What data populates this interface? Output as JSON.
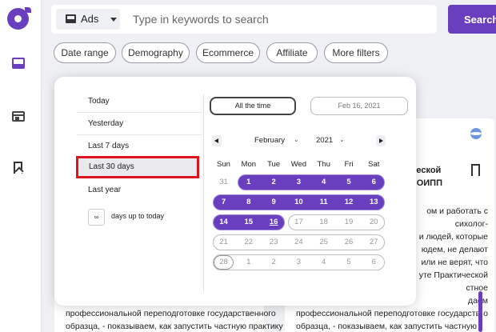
{
  "search": {
    "type_label": "Ads",
    "placeholder": "Type in keywords to search",
    "button_label": "Search"
  },
  "filters": [
    "Date range",
    "Demography",
    "Ecommerce",
    "Affiliate",
    "More filters"
  ],
  "date_picker": {
    "presets": [
      "Today",
      "Yesterday",
      "Last 7 days",
      "Last 30 days",
      "Last year"
    ],
    "selected_preset": "Last 30 days",
    "days_input": "∞",
    "days_label": "days up to today",
    "all_time_label": "All the time",
    "end_date": "Feb 16, 2021",
    "month": "February",
    "year": "2021",
    "weekdays": [
      "Sun",
      "Mon",
      "Tue",
      "Wed",
      "Thu",
      "Fri",
      "Sat"
    ],
    "weeks": [
      [
        "31",
        "1",
        "2",
        "3",
        "4",
        "5",
        "6"
      ],
      [
        "7",
        "8",
        "9",
        "10",
        "11",
        "12",
        "13"
      ],
      [
        "14",
        "15",
        "16",
        "17",
        "18",
        "19",
        "20"
      ],
      [
        "21",
        "22",
        "23",
        "24",
        "25",
        "26",
        "27"
      ],
      [
        "28",
        "1",
        "2",
        "3",
        "4",
        "5",
        "6"
      ]
    ],
    "selected_range": [
      "1",
      "16"
    ],
    "today": "16"
  },
  "cards": {
    "left_footer": [
      "профессиональной переподготовке государственного",
      "образца, - показываем, как запустить частную практику"
    ],
    "right_title": [
      "ческой",
      "- ОИПП"
    ],
    "right_text": [
      "ом и работать с",
      "сихолог-",
      "и людей, которые",
      "юдем, не делают",
      "или не верят, что",
      "уте Практической",
      "стное",
      "даем",
      "о"
    ],
    "right_footer": [
      "профессиональной переподготовке государственного",
      "образца, - показываем, как запустить частную практику"
    ]
  },
  "icons": {
    "logo": "logo-icon",
    "nav": [
      "ads-icon",
      "browser-icon",
      "bookmark-icon"
    ],
    "search_type": "ads-icon",
    "card_flag": "flag-icon",
    "card_bookmark": "bookmark-icon"
  },
  "colors": {
    "brand": "#6a3fbf",
    "highlight": "#e0141d",
    "background": "#eef0f4"
  }
}
